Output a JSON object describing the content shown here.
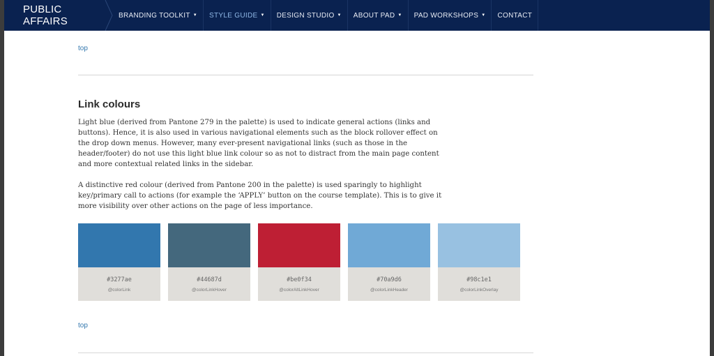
{
  "nav": {
    "brand": "PUBLIC AFFAIRS",
    "items": [
      {
        "label": "BRANDING TOOLKIT",
        "dropdown": true
      },
      {
        "label": "STYLE GUIDE",
        "dropdown": true,
        "active": true
      },
      {
        "label": "DESIGN STUDIO",
        "dropdown": true
      },
      {
        "label": "ABOUT PAD",
        "dropdown": true
      },
      {
        "label": "PAD WORKSHOPS",
        "dropdown": true
      },
      {
        "label": "CONTACT",
        "dropdown": false
      }
    ],
    "caret": "▼"
  },
  "main": {
    "top_link_1": "top",
    "heading": "Link colours",
    "para_1": "Light blue (derived from Pantone 279 in the palette) is used to indicate general actions (links and buttons). Hence, it is also used in various navigational elements such as the block rollover effect on the drop down menus. However, many ever-present navigational links (such as those in the header/footer) do not use this light blue link colour so as not to distract from the main page content and more contextual related links in the sidebar.",
    "para_2": "A distinctive red colour (derived from Pantone 200 in the palette) is used sparingly to highlight key/primary call to actions (for example the ‘APPLY’ button on the course template). This is to give it more visibility over other actions on the page of less importance.",
    "swatches": [
      {
        "hex": "#3277ae",
        "var": "@colorLink",
        "color": "#3277ae"
      },
      {
        "hex": "#44687d",
        "var": "@colorLinkHover",
        "color": "#44687d"
      },
      {
        "hex": "#be0f34",
        "var": "@colorAltLinkHover",
        "color": "#be1f34"
      },
      {
        "hex": "#70a9d6",
        "var": "@colorLinkHeader",
        "color": "#70a9d6"
      },
      {
        "hex": "#98c1e1",
        "var": "@colorLinkOverlay",
        "color": "#98c1e1"
      }
    ],
    "top_link_2": "top"
  },
  "colors": {
    "nav_bg": "#0a2250",
    "link": "#3277ae"
  }
}
